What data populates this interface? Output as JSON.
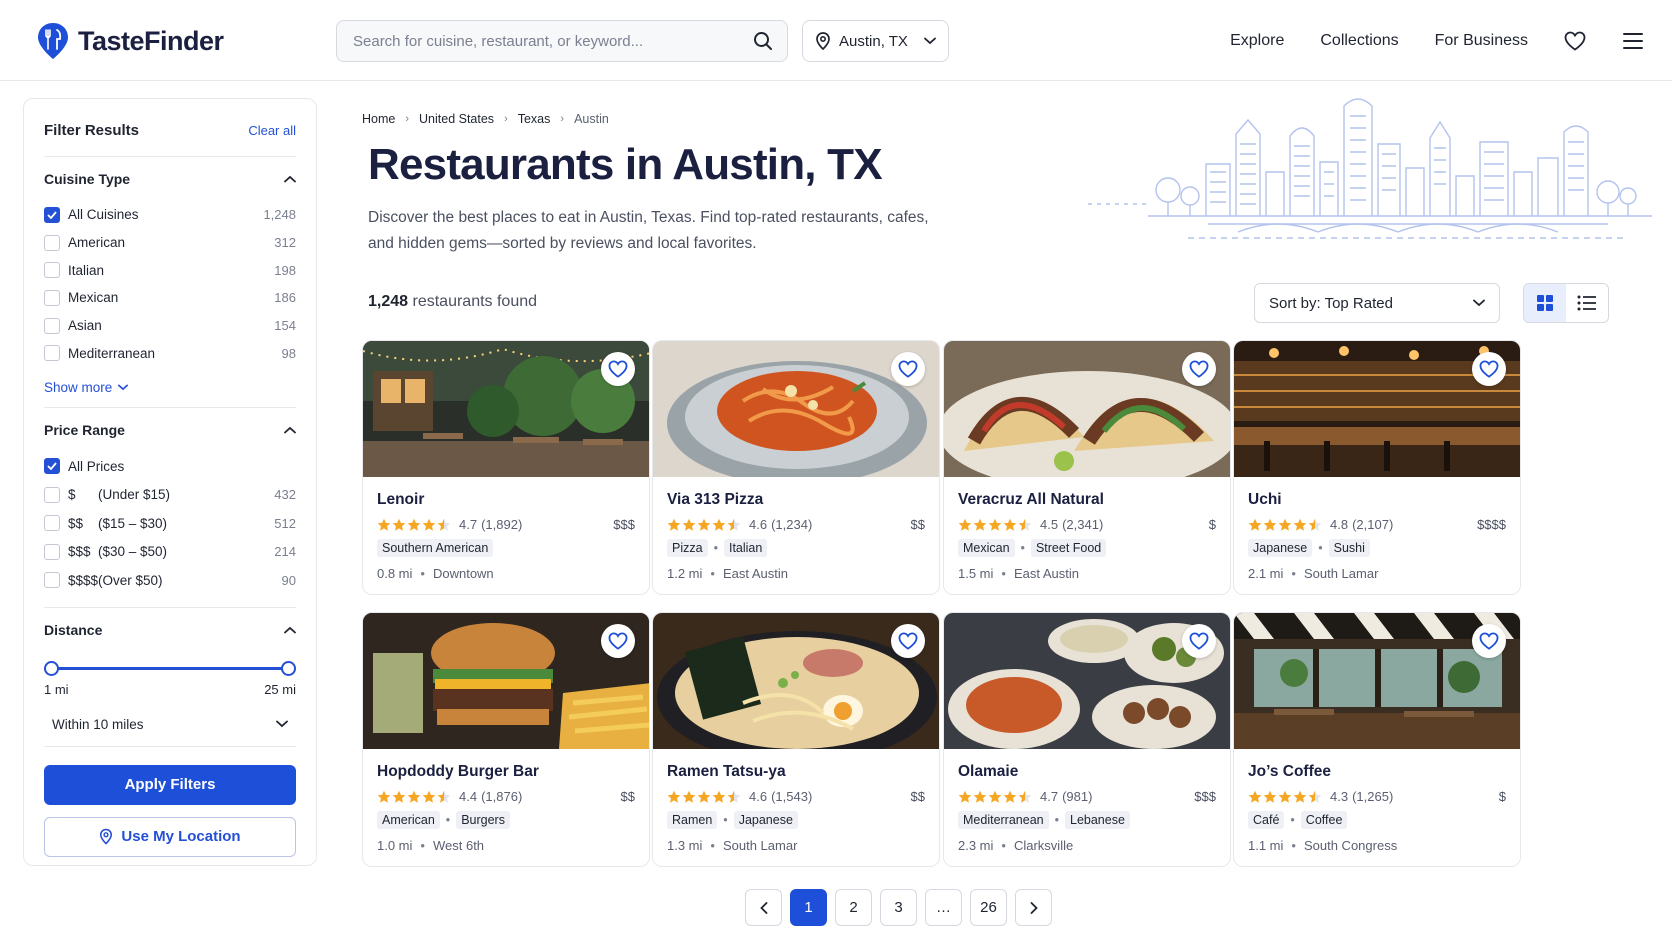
{
  "app": {
    "name": "TasteFinder"
  },
  "search": {
    "placeholder": "Search for cuisine, restaurant, or keyword..."
  },
  "location": {
    "value": "Austin, TX"
  },
  "nav": {
    "explore": "Explore",
    "collections": "Collections",
    "business": "For Business"
  },
  "sidebar": {
    "title": "Filter Results",
    "clear_all": "Clear all",
    "cuisine": {
      "title": "Cuisine Type",
      "options": [
        {
          "label": "All Cuisines",
          "count": "1,248",
          "checked": true
        },
        {
          "label": "American",
          "count": "312",
          "checked": false
        },
        {
          "label": "Italian",
          "count": "198",
          "checked": false
        },
        {
          "label": "Mexican",
          "count": "186",
          "checked": false
        },
        {
          "label": "Asian",
          "count": "154",
          "checked": false
        },
        {
          "label": "Mediterranean",
          "count": "98",
          "checked": false
        }
      ],
      "show_more": "Show more"
    },
    "price": {
      "title": "Price Range",
      "all_label": "All Prices",
      "options": [
        {
          "symbol": "$",
          "range": "(Under $15)",
          "count": "432"
        },
        {
          "symbol": "$$",
          "range": "($15 – $30)",
          "count": "512"
        },
        {
          "symbol": "$$$",
          "range": "($30 – $50)",
          "count": "214"
        },
        {
          "symbol": "$$$$",
          "range": "(Over $50)",
          "count": "90"
        }
      ]
    },
    "distance": {
      "title": "Distance",
      "min_label": "1 mi",
      "max_label": "25 mi",
      "within": "Within 10 miles"
    },
    "apply": "Apply Filters",
    "use_location": "Use My Location"
  },
  "breadcrumb": [
    "Home",
    "United States",
    "Texas",
    "Austin"
  ],
  "page": {
    "title": "Restaurants in Austin, TX",
    "description": "Discover the best places to eat in Austin, Texas. Find top-rated restaurants, cafes, and hidden gems—sorted by reviews and local favorites."
  },
  "results": {
    "count": "1,248",
    "label": "restaurants found"
  },
  "sort": {
    "label": "Sort by: Top Rated"
  },
  "restaurants": [
    {
      "name": "Lenoir",
      "rating": "4.7",
      "reviews": "(1,892)",
      "price": "$$$",
      "tags": [
        "Southern American"
      ],
      "distance": "0.8 mi",
      "area": "Downtown",
      "scene": "patio"
    },
    {
      "name": "Via 313 Pizza",
      "rating": "4.6",
      "reviews": "(1,234)",
      "price": "$$",
      "tags": [
        "Pizza",
        "Italian"
      ],
      "distance": "1.2 mi",
      "area": "East Austin",
      "scene": "pasta"
    },
    {
      "name": "Veracruz All Natural",
      "rating": "4.5",
      "reviews": "(2,341)",
      "price": "$",
      "tags": [
        "Mexican",
        "Street Food"
      ],
      "distance": "1.5 mi",
      "area": "East Austin",
      "scene": "tacos"
    },
    {
      "name": "Uchi",
      "rating": "4.8",
      "reviews": "(2,107)",
      "price": "$$$$",
      "tags": [
        "Japanese",
        "Sushi"
      ],
      "distance": "2.1 mi",
      "area": "South Lamar",
      "scene": "bar"
    },
    {
      "name": "Hopdoddy Burger Bar",
      "rating": "4.4",
      "reviews": "(1,876)",
      "price": "$$",
      "tags": [
        "American",
        "Burgers"
      ],
      "distance": "1.0 mi",
      "area": "West 6th",
      "scene": "burger"
    },
    {
      "name": "Ramen Tatsu-ya",
      "rating": "4.6",
      "reviews": "(1,543)",
      "price": "$$",
      "tags": [
        "Ramen",
        "Japanese"
      ],
      "distance": "1.3 mi",
      "area": "South Lamar",
      "scene": "ramen"
    },
    {
      "name": "Olamaie",
      "rating": "4.7",
      "reviews": "(981)",
      "price": "$$$",
      "tags": [
        "Mediterranean",
        "Lebanese"
      ],
      "distance": "2.3 mi",
      "area": "Clarksville",
      "scene": "mezze"
    },
    {
      "name": "Jo’s Coffee",
      "rating": "4.3",
      "reviews": "(1,265)",
      "price": "$",
      "tags": [
        "Café",
        "Coffee"
      ],
      "distance": "1.1 mi",
      "area": "South Congress",
      "scene": "cafe"
    }
  ],
  "pagination": {
    "pages": [
      "1",
      "2",
      "3",
      "…",
      "26"
    ],
    "current": "1"
  },
  "colors": {
    "accent": "#1e4fd8",
    "star": "#f5a623"
  }
}
